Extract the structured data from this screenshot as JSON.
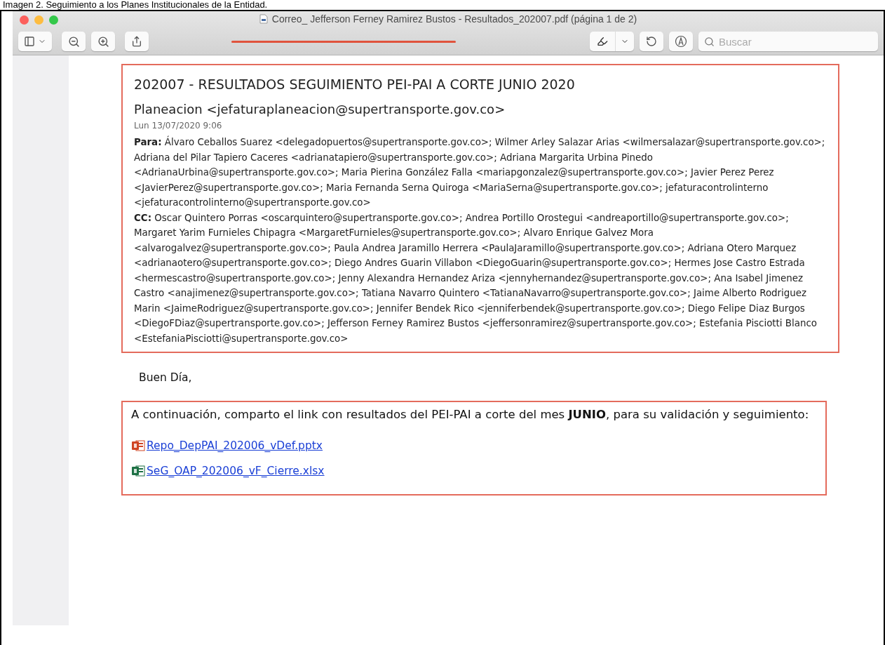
{
  "caption": "Imagen 2. Seguimiento a los Planes Institucionales de la Entidad.",
  "window": {
    "title": "Correo_ Jefferson Ferney Ramirez Bustos - Resultados_202007.pdf (página 1 de 2)"
  },
  "toolbar": {
    "search": {
      "placeholder": "Buscar"
    }
  },
  "email": {
    "subject": "202007 - RESULTADOS SEGUIMIENTO PEI-PAI A CORTE JUNIO 2020",
    "sender": "Planeacion <jefaturaplaneacion@supertransporte.gov.co>",
    "date": "Lun 13/07/2020 9:06",
    "recipients": [
      "**Para:**  Álvaro Ceballos Suarez <delegadopuertos@supertransporte.gov.co>; Wilmer Arley Salazar Arias <wilmersalazar@supertransporte.gov.co>; Adriana del Pilar Tapiero Caceres <adrianatapiero@supertransporte.gov.co>; Adriana Margarita Urbina Pinedo <AdrianaUrbina@supertransporte.gov.co>; Maria Pierina González Falla <mariapgonzalez@supertransporte.gov.co>; Javier Perez Perez <JavierPerez@supertransporte.gov.co>; Maria Fernanda Serna Quiroga <MariaSerna@supertransporte.gov.co>; jefaturacontrolinterno <jefaturacontrolinterno@supertransporte.gov.co>",
      "**CC:**  Oscar Quintero Porras <oscarquintero@supertransporte.gov.co>; Andrea Portillo Orostegui <andreaportillo@supertransporte.gov.co>; Margaret Yarim Furnieles Chipagra <MargaretFurnieles@supertransporte.gov.co>; Alvaro Enrique Galvez Mora <alvarogalvez@supertransporte.gov.co>; Paula Andrea Jaramillo Herrera <PaulaJaramillo@supertransporte.gov.co>; Adriana Otero Marquez <adrianaotero@supertransporte.gov.co>; Diego Andres Guarin Villabon <DiegoGuarin@supertransporte.gov.co>; Hermes Jose Castro Estrada <hermescastro@supertransporte.gov.co>; Jenny Alexandra Hernandez Ariza <jennyhernandez@supertransporte.gov.co>; Ana Isabel Jimenez Castro <anajimenez@supertransporte.gov.co>; Tatiana Navarro Quintero <TatianaNavarro@supertransporte.gov.co>; Jaime Alberto Rodriguez Marin <JaimeRodriguez@supertransporte.gov.co>; Jennifer Bendek Rico <jenniferbendek@supertransporte.gov.co>; Diego Felipe Diaz Burgos <DiegoFDiaz@supertransporte.gov.co>; Jefferson Ferney Ramirez Bustos <jeffersonramirez@supertransporte.gov.co>; Estefania Pisciotti Blanco <EstefaniaPisciotti@supertransporte.gov.co>"
    ],
    "greeting": "Buen Día,",
    "body": "A continuación, comparto el link con resultados del PEI-PAI a corte del mes **JUNIO**, para su validación y seguimiento:",
    "attachments": [
      {
        "kind": "pptx",
        "name": "Repo_DepPAI_202006_vDef.pptx"
      },
      {
        "kind": "xlsx",
        "name": "SeG_OAP_202006_vF_Cierre.xlsx"
      }
    ]
  }
}
